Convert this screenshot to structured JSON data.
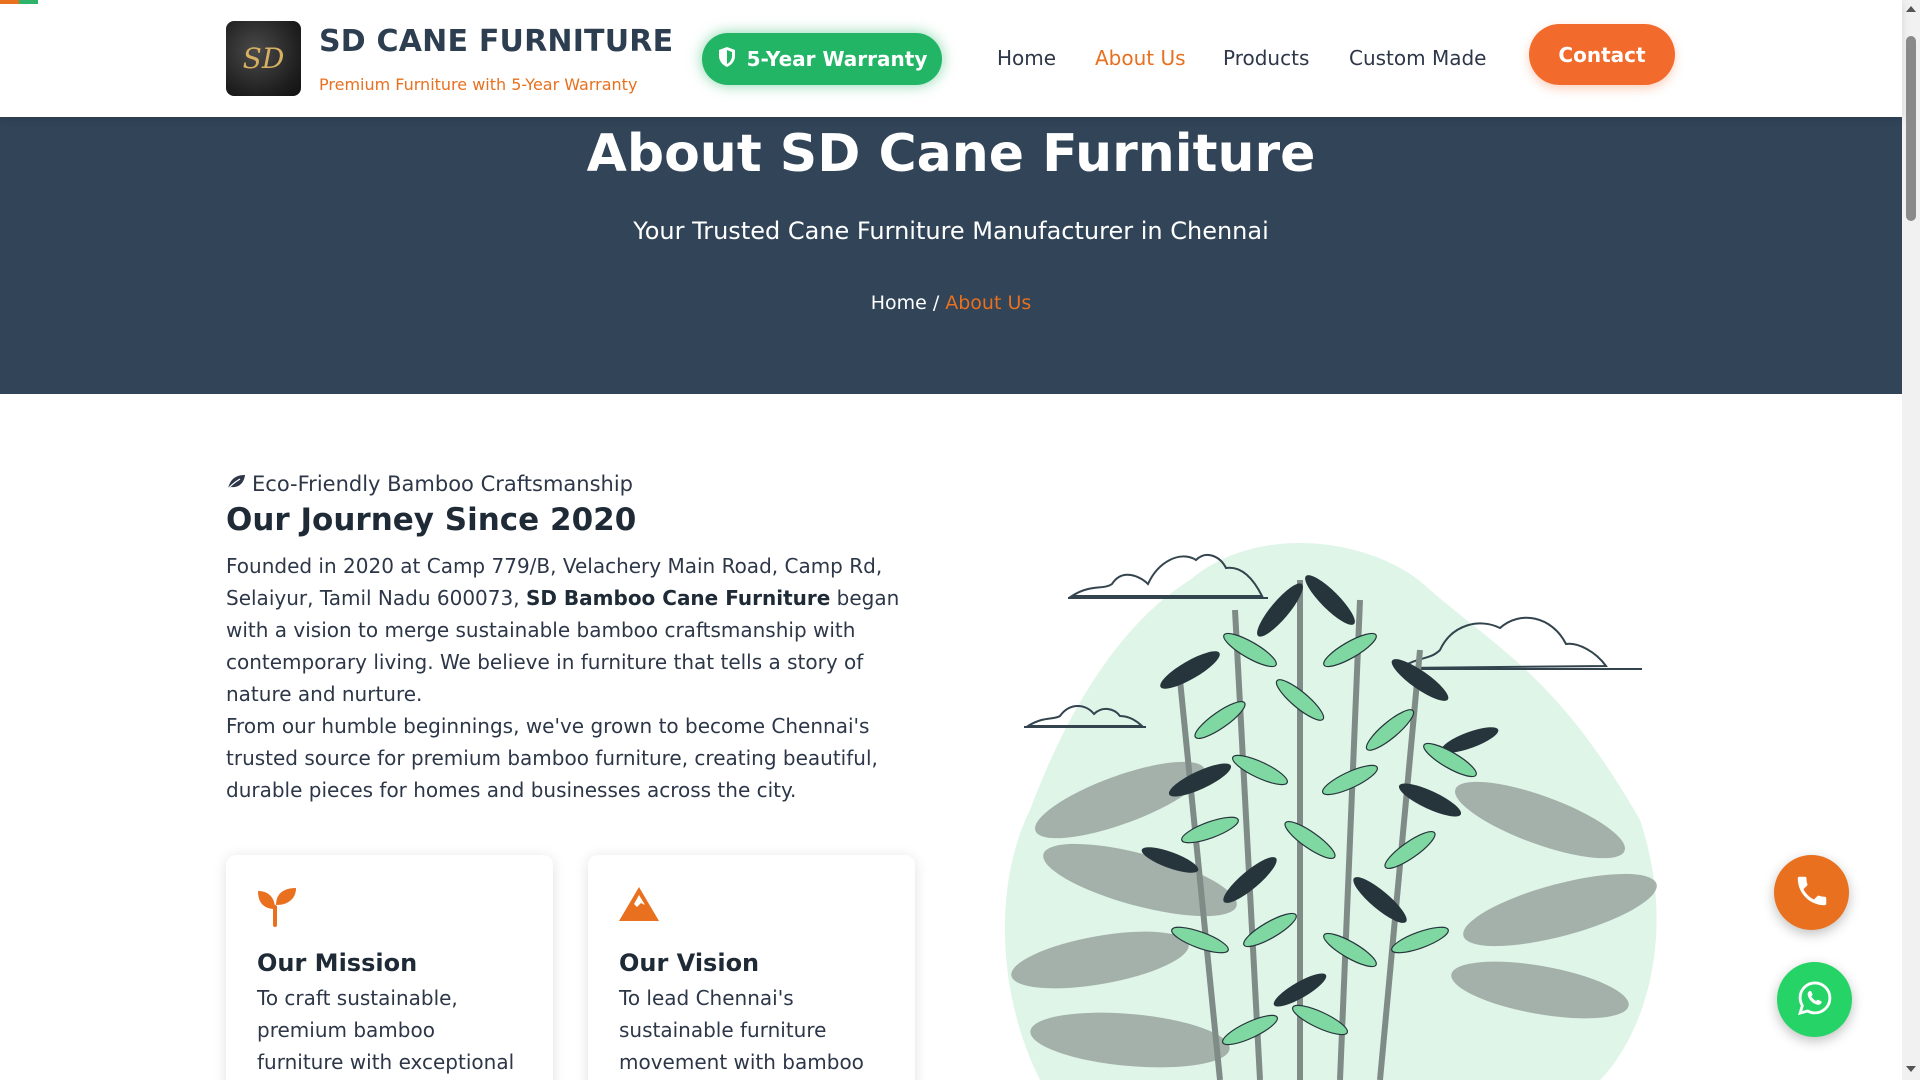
{
  "header": {
    "logo_text": "SD",
    "brand_name": "SD CANE FURNITURE",
    "tagline": "Premium Furniture with 5-Year Warranty",
    "warranty_label": "5-Year Warranty",
    "nav": [
      {
        "label": "Home",
        "active": false
      },
      {
        "label": "About Us",
        "active": true
      },
      {
        "label": "Products",
        "active": false
      },
      {
        "label": "Custom Made",
        "active": false
      }
    ],
    "contact_label": "Contact"
  },
  "hero": {
    "title": "About SD Cane Furniture",
    "subtitle": "Your Trusted Cane Furniture Manufacturer in Chennai",
    "breadcrumb": {
      "home": "Home",
      "separator": "/",
      "current": "About Us"
    }
  },
  "about": {
    "eyebrow": "Eco-Friendly Bamboo Craftsmanship",
    "title": "Our Journey Since 2020",
    "para1_before": "Founded in 2020 at Camp 779/B, Velachery Main Road, Camp Rd, Selaiyur, Tamil Nadu 600073, ",
    "para1_bold": "SD Bamboo Cane Furniture",
    "para1_after": " began with a vision to merge sustainable bamboo craftsmanship with contemporary living. We believe in furniture that tells a story of nature and nurture.",
    "para2": "From our humble beginnings, we've grown to become Chennai's trusted source for premium bamboo furniture, creating beautiful, durable pieces for homes and businesses across the city."
  },
  "cards": [
    {
      "icon": "seedling-icon",
      "title": "Our Mission",
      "text": "To craft sustainable, premium bamboo furniture with exceptional"
    },
    {
      "icon": "mountain-icon",
      "title": "Our Vision",
      "text": "To lead Chennai's sustainable furniture movement with bamboo"
    }
  ],
  "colors": {
    "accent": "#e8701e",
    "hero_bg": "#314458",
    "warranty_green": "#22b566",
    "contact_orange": "#f26a2c",
    "whatsapp_green": "#25d366"
  },
  "floating": {
    "phone_icon": "phone-icon",
    "whatsapp_icon": "whatsapp-icon"
  }
}
